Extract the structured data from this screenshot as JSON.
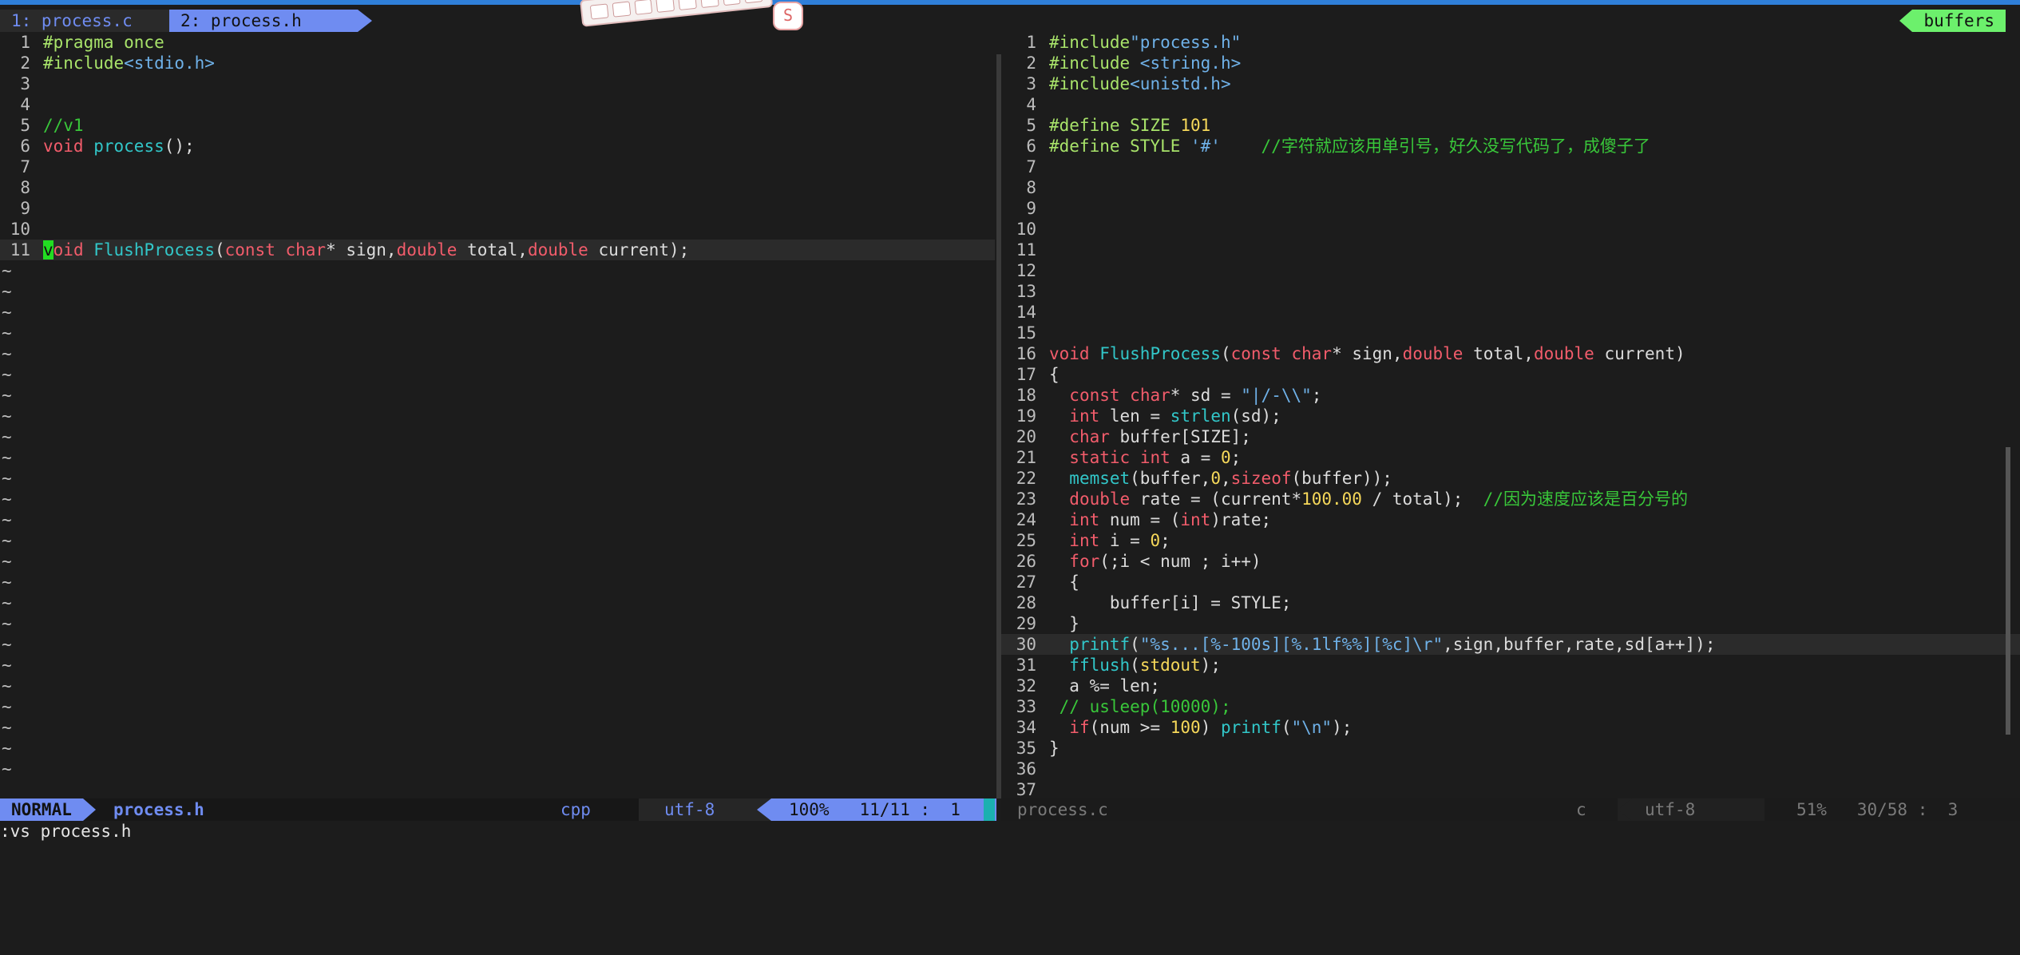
{
  "tabs": [
    {
      "label": "1: process.c"
    },
    {
      "label": "2: process.h"
    }
  ],
  "buffers_label": "buffers",
  "keycap": "S",
  "left_pane": {
    "lines": [
      {
        "n": "1",
        "segs": [
          {
            "c": "pp",
            "t": "#pragma once"
          }
        ]
      },
      {
        "n": "2",
        "segs": [
          {
            "c": "pp",
            "t": "#include"
          },
          {
            "c": "str",
            "t": "<stdio.h>"
          }
        ]
      },
      {
        "n": "3",
        "segs": []
      },
      {
        "n": "4",
        "segs": []
      },
      {
        "n": "5",
        "segs": [
          {
            "c": "cmt",
            "t": "//v1"
          }
        ]
      },
      {
        "n": "6",
        "segs": [
          {
            "c": "t",
            "t": "void"
          },
          {
            "c": "",
            "t": " "
          },
          {
            "c": "f",
            "t": "process"
          },
          {
            "c": "",
            "t": "();"
          }
        ]
      },
      {
        "n": "7",
        "segs": []
      },
      {
        "n": "8",
        "segs": []
      },
      {
        "n": "9",
        "segs": []
      },
      {
        "n": "10",
        "segs": []
      },
      {
        "n": "11",
        "cursorline": true,
        "segs": [
          {
            "c": "cursor",
            "t": "v"
          },
          {
            "c": "t",
            "t": "oid"
          },
          {
            "c": "",
            "t": " "
          },
          {
            "c": "f",
            "t": "FlushProcess"
          },
          {
            "c": "",
            "t": "("
          },
          {
            "c": "t",
            "t": "const"
          },
          {
            "c": "",
            "t": " "
          },
          {
            "c": "t",
            "t": "char"
          },
          {
            "c": "",
            "t": "* sign,"
          },
          {
            "c": "t",
            "t": "double"
          },
          {
            "c": "",
            "t": " total,"
          },
          {
            "c": "t",
            "t": "double"
          },
          {
            "c": "",
            "t": " current);"
          }
        ]
      }
    ],
    "tilde_count": 25,
    "tilde": "~"
  },
  "right_pane": {
    "lines": [
      {
        "n": "1",
        "segs": [
          {
            "c": "pp",
            "t": "#include"
          },
          {
            "c": "str",
            "t": "\"process.h\""
          }
        ]
      },
      {
        "n": "2",
        "segs": [
          {
            "c": "pp",
            "t": "#include "
          },
          {
            "c": "str",
            "t": "<string.h>"
          }
        ]
      },
      {
        "n": "3",
        "segs": [
          {
            "c": "pp",
            "t": "#include"
          },
          {
            "c": "str",
            "t": "<unistd.h>"
          }
        ]
      },
      {
        "n": "4",
        "segs": []
      },
      {
        "n": "5",
        "segs": [
          {
            "c": "pp",
            "t": "#define SIZE "
          },
          {
            "c": "n",
            "t": "101"
          }
        ]
      },
      {
        "n": "6",
        "segs": [
          {
            "c": "pp",
            "t": "#define STYLE "
          },
          {
            "c": "str",
            "t": "'#'"
          },
          {
            "c": "",
            "t": "    "
          },
          {
            "c": "cmt",
            "t": "//字符就应该用单引号，好久没写代码了，成傻子了"
          }
        ]
      },
      {
        "n": "7",
        "segs": []
      },
      {
        "n": "8",
        "segs": []
      },
      {
        "n": "9",
        "segs": []
      },
      {
        "n": "10",
        "segs": []
      },
      {
        "n": "11",
        "segs": []
      },
      {
        "n": "12",
        "segs": []
      },
      {
        "n": "13",
        "segs": []
      },
      {
        "n": "14",
        "segs": []
      },
      {
        "n": "15",
        "segs": []
      },
      {
        "n": "16",
        "segs": [
          {
            "c": "t",
            "t": "void"
          },
          {
            "c": "",
            "t": " "
          },
          {
            "c": "f",
            "t": "FlushProcess"
          },
          {
            "c": "",
            "t": "("
          },
          {
            "c": "t",
            "t": "const"
          },
          {
            "c": "",
            "t": " "
          },
          {
            "c": "t",
            "t": "char"
          },
          {
            "c": "",
            "t": "* sign,"
          },
          {
            "c": "t",
            "t": "double"
          },
          {
            "c": "",
            "t": " total,"
          },
          {
            "c": "t",
            "t": "double"
          },
          {
            "c": "",
            "t": " current)"
          }
        ]
      },
      {
        "n": "17",
        "segs": [
          {
            "c": "",
            "t": "{"
          }
        ]
      },
      {
        "n": "18",
        "segs": [
          {
            "c": "",
            "t": "  "
          },
          {
            "c": "t",
            "t": "const"
          },
          {
            "c": "",
            "t": " "
          },
          {
            "c": "t",
            "t": "char"
          },
          {
            "c": "",
            "t": "* sd = "
          },
          {
            "c": "str",
            "t": "\"|/-\\\\\""
          },
          {
            "c": "",
            "t": ";"
          }
        ]
      },
      {
        "n": "19",
        "segs": [
          {
            "c": "",
            "t": "  "
          },
          {
            "c": "t",
            "t": "int"
          },
          {
            "c": "",
            "t": " len = "
          },
          {
            "c": "f",
            "t": "strlen"
          },
          {
            "c": "",
            "t": "(sd);"
          }
        ]
      },
      {
        "n": "20",
        "segs": [
          {
            "c": "",
            "t": "  "
          },
          {
            "c": "t",
            "t": "char"
          },
          {
            "c": "",
            "t": " buffer[SIZE];"
          }
        ]
      },
      {
        "n": "21",
        "segs": [
          {
            "c": "",
            "t": "  "
          },
          {
            "c": "t",
            "t": "static"
          },
          {
            "c": "",
            "t": " "
          },
          {
            "c": "t",
            "t": "int"
          },
          {
            "c": "",
            "t": " a = "
          },
          {
            "c": "n",
            "t": "0"
          },
          {
            "c": "",
            "t": ";"
          }
        ]
      },
      {
        "n": "22",
        "segs": [
          {
            "c": "",
            "t": "  "
          },
          {
            "c": "f",
            "t": "memset"
          },
          {
            "c": "",
            "t": "(buffer,"
          },
          {
            "c": "n",
            "t": "0"
          },
          {
            "c": "",
            "t": ","
          },
          {
            "c": "k",
            "t": "sizeof"
          },
          {
            "c": "",
            "t": "(buffer));"
          }
        ]
      },
      {
        "n": "23",
        "segs": [
          {
            "c": "",
            "t": "  "
          },
          {
            "c": "t",
            "t": "double"
          },
          {
            "c": "",
            "t": " rate = (current*"
          },
          {
            "c": "n",
            "t": "100.00"
          },
          {
            "c": "",
            "t": " / total);  "
          },
          {
            "c": "cmt",
            "t": "//因为速度应该是百分号的"
          }
        ]
      },
      {
        "n": "24",
        "segs": [
          {
            "c": "",
            "t": "  "
          },
          {
            "c": "t",
            "t": "int"
          },
          {
            "c": "",
            "t": " num = ("
          },
          {
            "c": "t",
            "t": "int"
          },
          {
            "c": "",
            "t": ")rate;"
          }
        ]
      },
      {
        "n": "25",
        "segs": [
          {
            "c": "",
            "t": "  "
          },
          {
            "c": "t",
            "t": "int"
          },
          {
            "c": "",
            "t": " i = "
          },
          {
            "c": "n",
            "t": "0"
          },
          {
            "c": "",
            "t": ";"
          }
        ]
      },
      {
        "n": "26",
        "segs": [
          {
            "c": "",
            "t": "  "
          },
          {
            "c": "k",
            "t": "for"
          },
          {
            "c": "",
            "t": "(;i < num ; i++)"
          }
        ]
      },
      {
        "n": "27",
        "segs": [
          {
            "c": "",
            "t": "  {"
          }
        ]
      },
      {
        "n": "28",
        "segs": [
          {
            "c": "",
            "t": "      buffer[i] = STYLE;"
          }
        ]
      },
      {
        "n": "29",
        "segs": [
          {
            "c": "",
            "t": "  }"
          }
        ]
      },
      {
        "n": "30",
        "cursorline": true,
        "segs": [
          {
            "c": "",
            "t": "  "
          },
          {
            "c": "f",
            "t": "printf"
          },
          {
            "c": "",
            "t": "("
          },
          {
            "c": "str",
            "t": "\"%s...[%-100s][%.1lf%%][%c]\\r\""
          },
          {
            "c": "",
            "t": ",sign,buffer,rate,sd[a++]);"
          }
        ]
      },
      {
        "n": "31",
        "segs": [
          {
            "c": "",
            "t": "  "
          },
          {
            "c": "f",
            "t": "fflush"
          },
          {
            "c": "",
            "t": "("
          },
          {
            "c": "n",
            "t": "stdout"
          },
          {
            "c": "",
            "t": ");"
          }
        ]
      },
      {
        "n": "32",
        "segs": [
          {
            "c": "",
            "t": "  a %= len;"
          }
        ]
      },
      {
        "n": "33",
        "segs": [
          {
            "c": "",
            "t": " "
          },
          {
            "c": "cmt",
            "t": "// usleep(10000);"
          }
        ]
      },
      {
        "n": "34",
        "segs": [
          {
            "c": "",
            "t": "  "
          },
          {
            "c": "k",
            "t": "if"
          },
          {
            "c": "",
            "t": "(num >= "
          },
          {
            "c": "n",
            "t": "100"
          },
          {
            "c": "",
            "t": ") "
          },
          {
            "c": "f",
            "t": "printf"
          },
          {
            "c": "",
            "t": "("
          },
          {
            "c": "str",
            "t": "\"\\n\""
          },
          {
            "c": "",
            "t": ");"
          }
        ]
      },
      {
        "n": "35",
        "segs": [
          {
            "c": "",
            "t": "}"
          }
        ]
      },
      {
        "n": "36",
        "segs": []
      },
      {
        "n": "37",
        "segs": []
      }
    ]
  },
  "status_left": {
    "mode": "NORMAL",
    "file": "process.h",
    "filetype": "cpp",
    "encoding": "utf-8",
    "position": "100%   11/11 :  1"
  },
  "status_right": {
    "file": "process.c",
    "filetype": "c",
    "encoding": "utf-8",
    "position": "51%   30/58 :  3"
  },
  "cmdline": ":vs process.h"
}
